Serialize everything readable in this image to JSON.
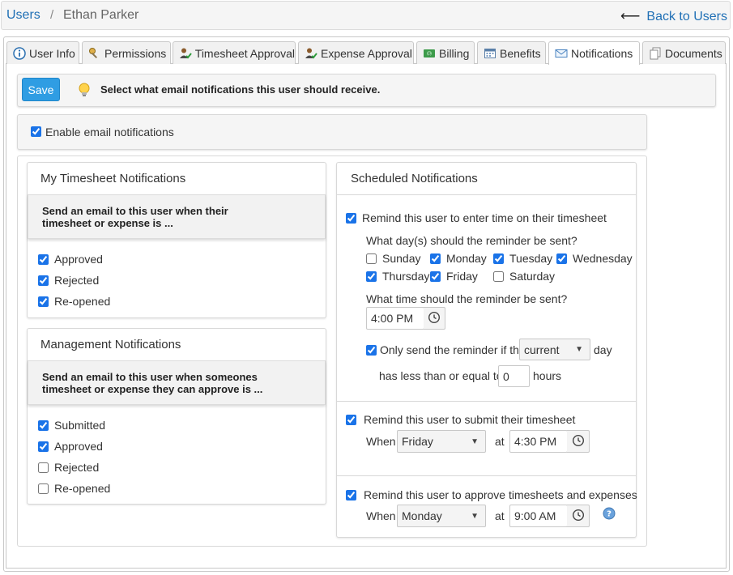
{
  "breadcrumb": {
    "users": "Users",
    "separator": "/",
    "user_name": "Ethan Parker"
  },
  "back_link": {
    "arrow": "⟵",
    "label": "Back to Users"
  },
  "tabs": [
    {
      "label": "User Info",
      "icon": "info-icon"
    },
    {
      "label": "Permissions",
      "icon": "key-icon"
    },
    {
      "label": "Timesheet Approval",
      "icon": "user-check-icon"
    },
    {
      "label": "Expense Approval",
      "icon": "user-check-icon"
    },
    {
      "label": "Billing",
      "icon": "money-icon"
    },
    {
      "label": "Benefits",
      "icon": "calendar-icon"
    },
    {
      "label": "Notifications",
      "icon": "envelope-icon",
      "active": true
    },
    {
      "label": "Documents",
      "icon": "documents-icon"
    }
  ],
  "toolbar": {
    "save_label": "Save",
    "message": "Select what email notifications this user should receive."
  },
  "enable": {
    "label": "Enable email notifications",
    "checked": true
  },
  "my_timesheet": {
    "title": "My Timesheet Notifications",
    "subheading": "Send an email to this user when their timesheet or expense is ...",
    "options": [
      {
        "label": "Approved",
        "checked": true
      },
      {
        "label": "Rejected",
        "checked": true
      },
      {
        "label": "Re-opened",
        "checked": true
      }
    ]
  },
  "management": {
    "title": "Management Notifications",
    "subheading": "Send an email to this user when someones timesheet or expense they can approve is ...",
    "options": [
      {
        "label": "Submitted",
        "checked": true
      },
      {
        "label": "Approved",
        "checked": true
      },
      {
        "label": "Rejected",
        "checked": false
      },
      {
        "label": "Re-opened",
        "checked": false
      }
    ]
  },
  "scheduled": {
    "title": "Scheduled Notifications",
    "enter_time": {
      "label": "Remind this user to enter time on their timesheet",
      "checked": true,
      "days_question": "What day(s) should the reminder be sent?",
      "days": [
        {
          "label": "Sunday",
          "checked": false
        },
        {
          "label": "Monday",
          "checked": true
        },
        {
          "label": "Tuesday",
          "checked": true
        },
        {
          "label": "Wednesday",
          "checked": true
        },
        {
          "label": "Thursday",
          "checked": true
        },
        {
          "label": "Friday",
          "checked": true
        },
        {
          "label": "Saturday",
          "checked": false
        }
      ],
      "time_question": "What time should the reminder be sent?",
      "time": "4:00 PM",
      "only_send_label": "Only send the reminder if the",
      "only_send_checked": true,
      "day_select": "current",
      "day_suffix": "day",
      "less_than_label": "has less than or equal to",
      "hours_value": "0",
      "hours_suffix": "hours"
    },
    "submit": {
      "label": "Remind this user to submit their timesheet",
      "checked": true,
      "when_label": "When",
      "day": "Friday",
      "at_label": "at",
      "time": "4:30 PM"
    },
    "approve": {
      "label": "Remind this user to approve timesheets and expenses",
      "checked": true,
      "when_label": "When",
      "day": "Monday",
      "at_label": "at",
      "time": "9:00 AM"
    }
  },
  "colors": {
    "link": "#1f6fb5",
    "save_button": "#2f9de3",
    "checkbox": "#1a73e8"
  }
}
